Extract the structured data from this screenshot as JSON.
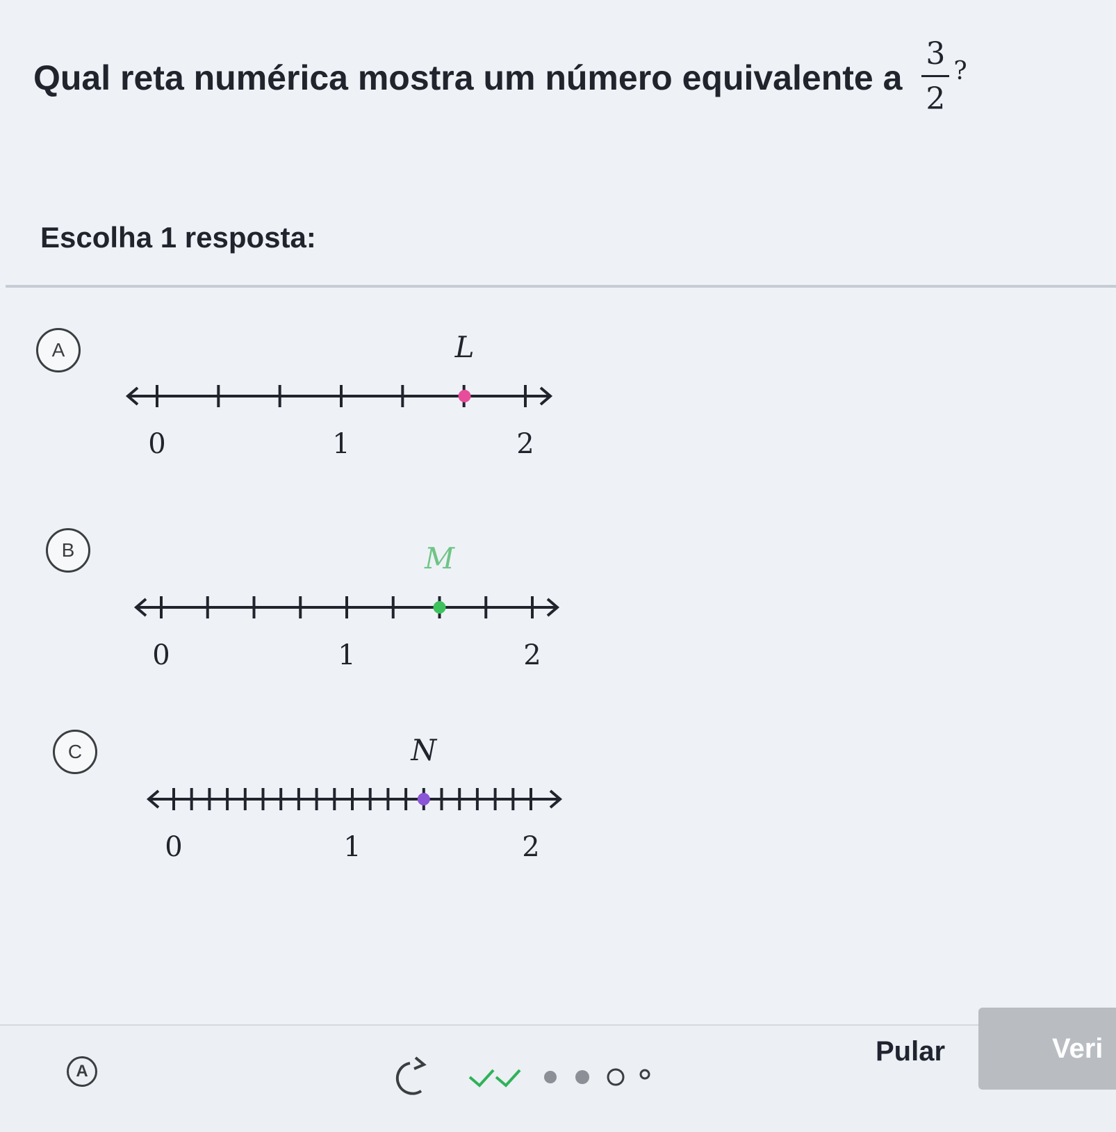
{
  "question": {
    "text": "Qual reta numérica mostra um número equivalente a",
    "fraction_numerator": "3",
    "fraction_denominator": "2",
    "question_mark": "?"
  },
  "instruction": "Escolha 1 resposta:",
  "choices": [
    {
      "letter": "A",
      "point_label": "L",
      "point_color": "#e84d9b",
      "divisions_per_unit": 3,
      "point_value": 1.67,
      "tick_labels": [
        "0",
        "1",
        "2"
      ]
    },
    {
      "letter": "B",
      "point_label": "M",
      "point_color": "#3ec25e",
      "point_label_color": "#6fc486",
      "divisions_per_unit": 4,
      "point_value": 1.5,
      "tick_labels": [
        "0",
        "1",
        "2"
      ]
    },
    {
      "letter": "C",
      "point_label": "N",
      "point_color": "#8a55d6",
      "divisions_per_unit": 10,
      "point_value": 1.4,
      "tick_labels": [
        "0",
        "1",
        "2"
      ]
    }
  ],
  "footer": {
    "hint_icon": "A",
    "skip_label": "Pular",
    "check_label": "Veri",
    "progress": [
      "check",
      "check",
      "dot",
      "dot",
      "circle",
      "circle-small"
    ]
  }
}
